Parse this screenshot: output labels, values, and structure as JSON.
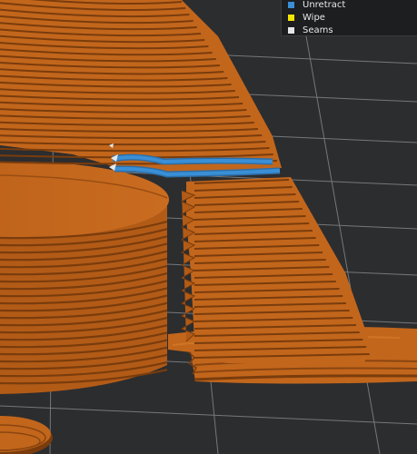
{
  "legend": {
    "items": [
      {
        "label": "Unretract",
        "color": "#3a8fd6"
      },
      {
        "label": "Wipe",
        "color": "#f2e600"
      },
      {
        "label": "Seams",
        "color": "#e6e6e6"
      }
    ]
  },
  "colors": {
    "background": "#2c2d2f",
    "grid": "#8e9094",
    "filament": "#c2661c",
    "filament_dark": "#7a3c0c",
    "unretract": "#3a8fd6"
  }
}
